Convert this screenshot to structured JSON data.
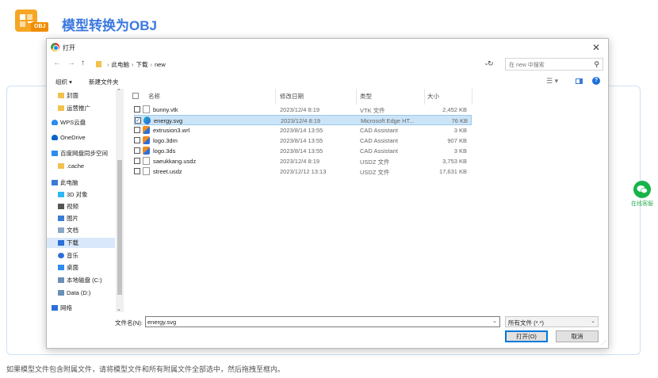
{
  "page": {
    "logo_tag": "OBJ",
    "title": "模型转换为OBJ",
    "hint": "如果模型文件包含附属文件，请将模型文件和所有附属文件全部选中，然后拖拽至框内。",
    "online_service": "在线客服"
  },
  "dialog": {
    "title": "打开",
    "close": "✕",
    "nav": {
      "back": "←",
      "forward": "→",
      "up": "↑"
    },
    "breadcrumb": [
      "此电脑",
      "下载",
      "new"
    ],
    "search_placeholder": "在 new 中搜索",
    "toolbar": {
      "organize": "组织 ▾",
      "new_folder": "新建文件夹",
      "help": "?"
    },
    "sidebar": [
      {
        "label": "封面",
        "icon": "folder-icon",
        "color": "#f2c14e"
      },
      {
        "label": "运营推广",
        "icon": "folder-icon",
        "color": "#f2c14e"
      },
      {
        "label": "WPS云盘",
        "icon": "cloud-icon",
        "color": "#2d8cf0"
      },
      {
        "label": "OneDrive",
        "icon": "cloud-icon",
        "color": "#0a64c8"
      },
      {
        "label": "百度网盘同步空间",
        "icon": "drive-icon",
        "color": "#2d8cf0"
      },
      {
        "label": ".cache",
        "icon": "folder-icon",
        "color": "#f2c14e"
      },
      {
        "label": "此电脑",
        "icon": "pc-icon",
        "color": "#3a7bd5"
      },
      {
        "label": "3D 对象",
        "icon": "cube-icon",
        "color": "#2db7f5"
      },
      {
        "label": "视频",
        "icon": "video-icon",
        "color": "#555555"
      },
      {
        "label": "图片",
        "icon": "image-icon",
        "color": "#3a7bd5"
      },
      {
        "label": "文档",
        "icon": "doc-icon",
        "color": "#8aa7c8"
      },
      {
        "label": "下载",
        "icon": "download-icon",
        "color": "#2d6fd9"
      },
      {
        "label": "音乐",
        "icon": "music-icon",
        "color": "#2d6fd9"
      },
      {
        "label": "桌面",
        "icon": "desktop-icon",
        "color": "#2d8cf0"
      },
      {
        "label": "本地磁盘 (C:)",
        "icon": "disk-icon",
        "color": "#6a8fb8"
      },
      {
        "label": "Data (D:)",
        "icon": "disk-icon",
        "color": "#6a8fb8"
      },
      {
        "label": "网络",
        "icon": "network-icon",
        "color": "#2d6fd9"
      }
    ],
    "columns": {
      "name": "名称",
      "date": "修改日期",
      "type": "类型",
      "size": "大小"
    },
    "files": [
      {
        "name": "bunny.vtk",
        "date": "2023/12/4 8:19",
        "type": "VTK 文件",
        "size": "2,452 KB",
        "icon": "file-icon"
      },
      {
        "name": "energy.svg",
        "date": "2023/12/4 8:19",
        "type": "Microsoft Edge HT...",
        "size": "76 KB",
        "icon": "edge-icon"
      },
      {
        "name": "extrusion3.wrl",
        "date": "2023/8/14 13:55",
        "type": "CAD Assistant",
        "size": "3 KB",
        "icon": "cad-icon"
      },
      {
        "name": "logo.3dm",
        "date": "2023/8/14 13:55",
        "type": "CAD Assistant",
        "size": "907 KB",
        "icon": "cad-icon"
      },
      {
        "name": "logo.3ds",
        "date": "2023/8/14 13:55",
        "type": "CAD Assistant",
        "size": "3 KB",
        "icon": "cad-icon"
      },
      {
        "name": "saeukkang.usdz",
        "date": "2023/12/4 8:19",
        "type": "USDZ 文件",
        "size": "3,753 KB",
        "icon": "file-icon"
      },
      {
        "name": "street.usdz",
        "date": "2023/12/12 13:13",
        "type": "USDZ 文件",
        "size": "17,631 KB",
        "icon": "file-icon"
      }
    ],
    "selected_file": "energy.svg",
    "filename_label": "文件名(N):",
    "filename_value": "energy.svg",
    "filter": "所有文件 (*.*)",
    "open_button": "打开(O)",
    "cancel_button": "取消"
  }
}
